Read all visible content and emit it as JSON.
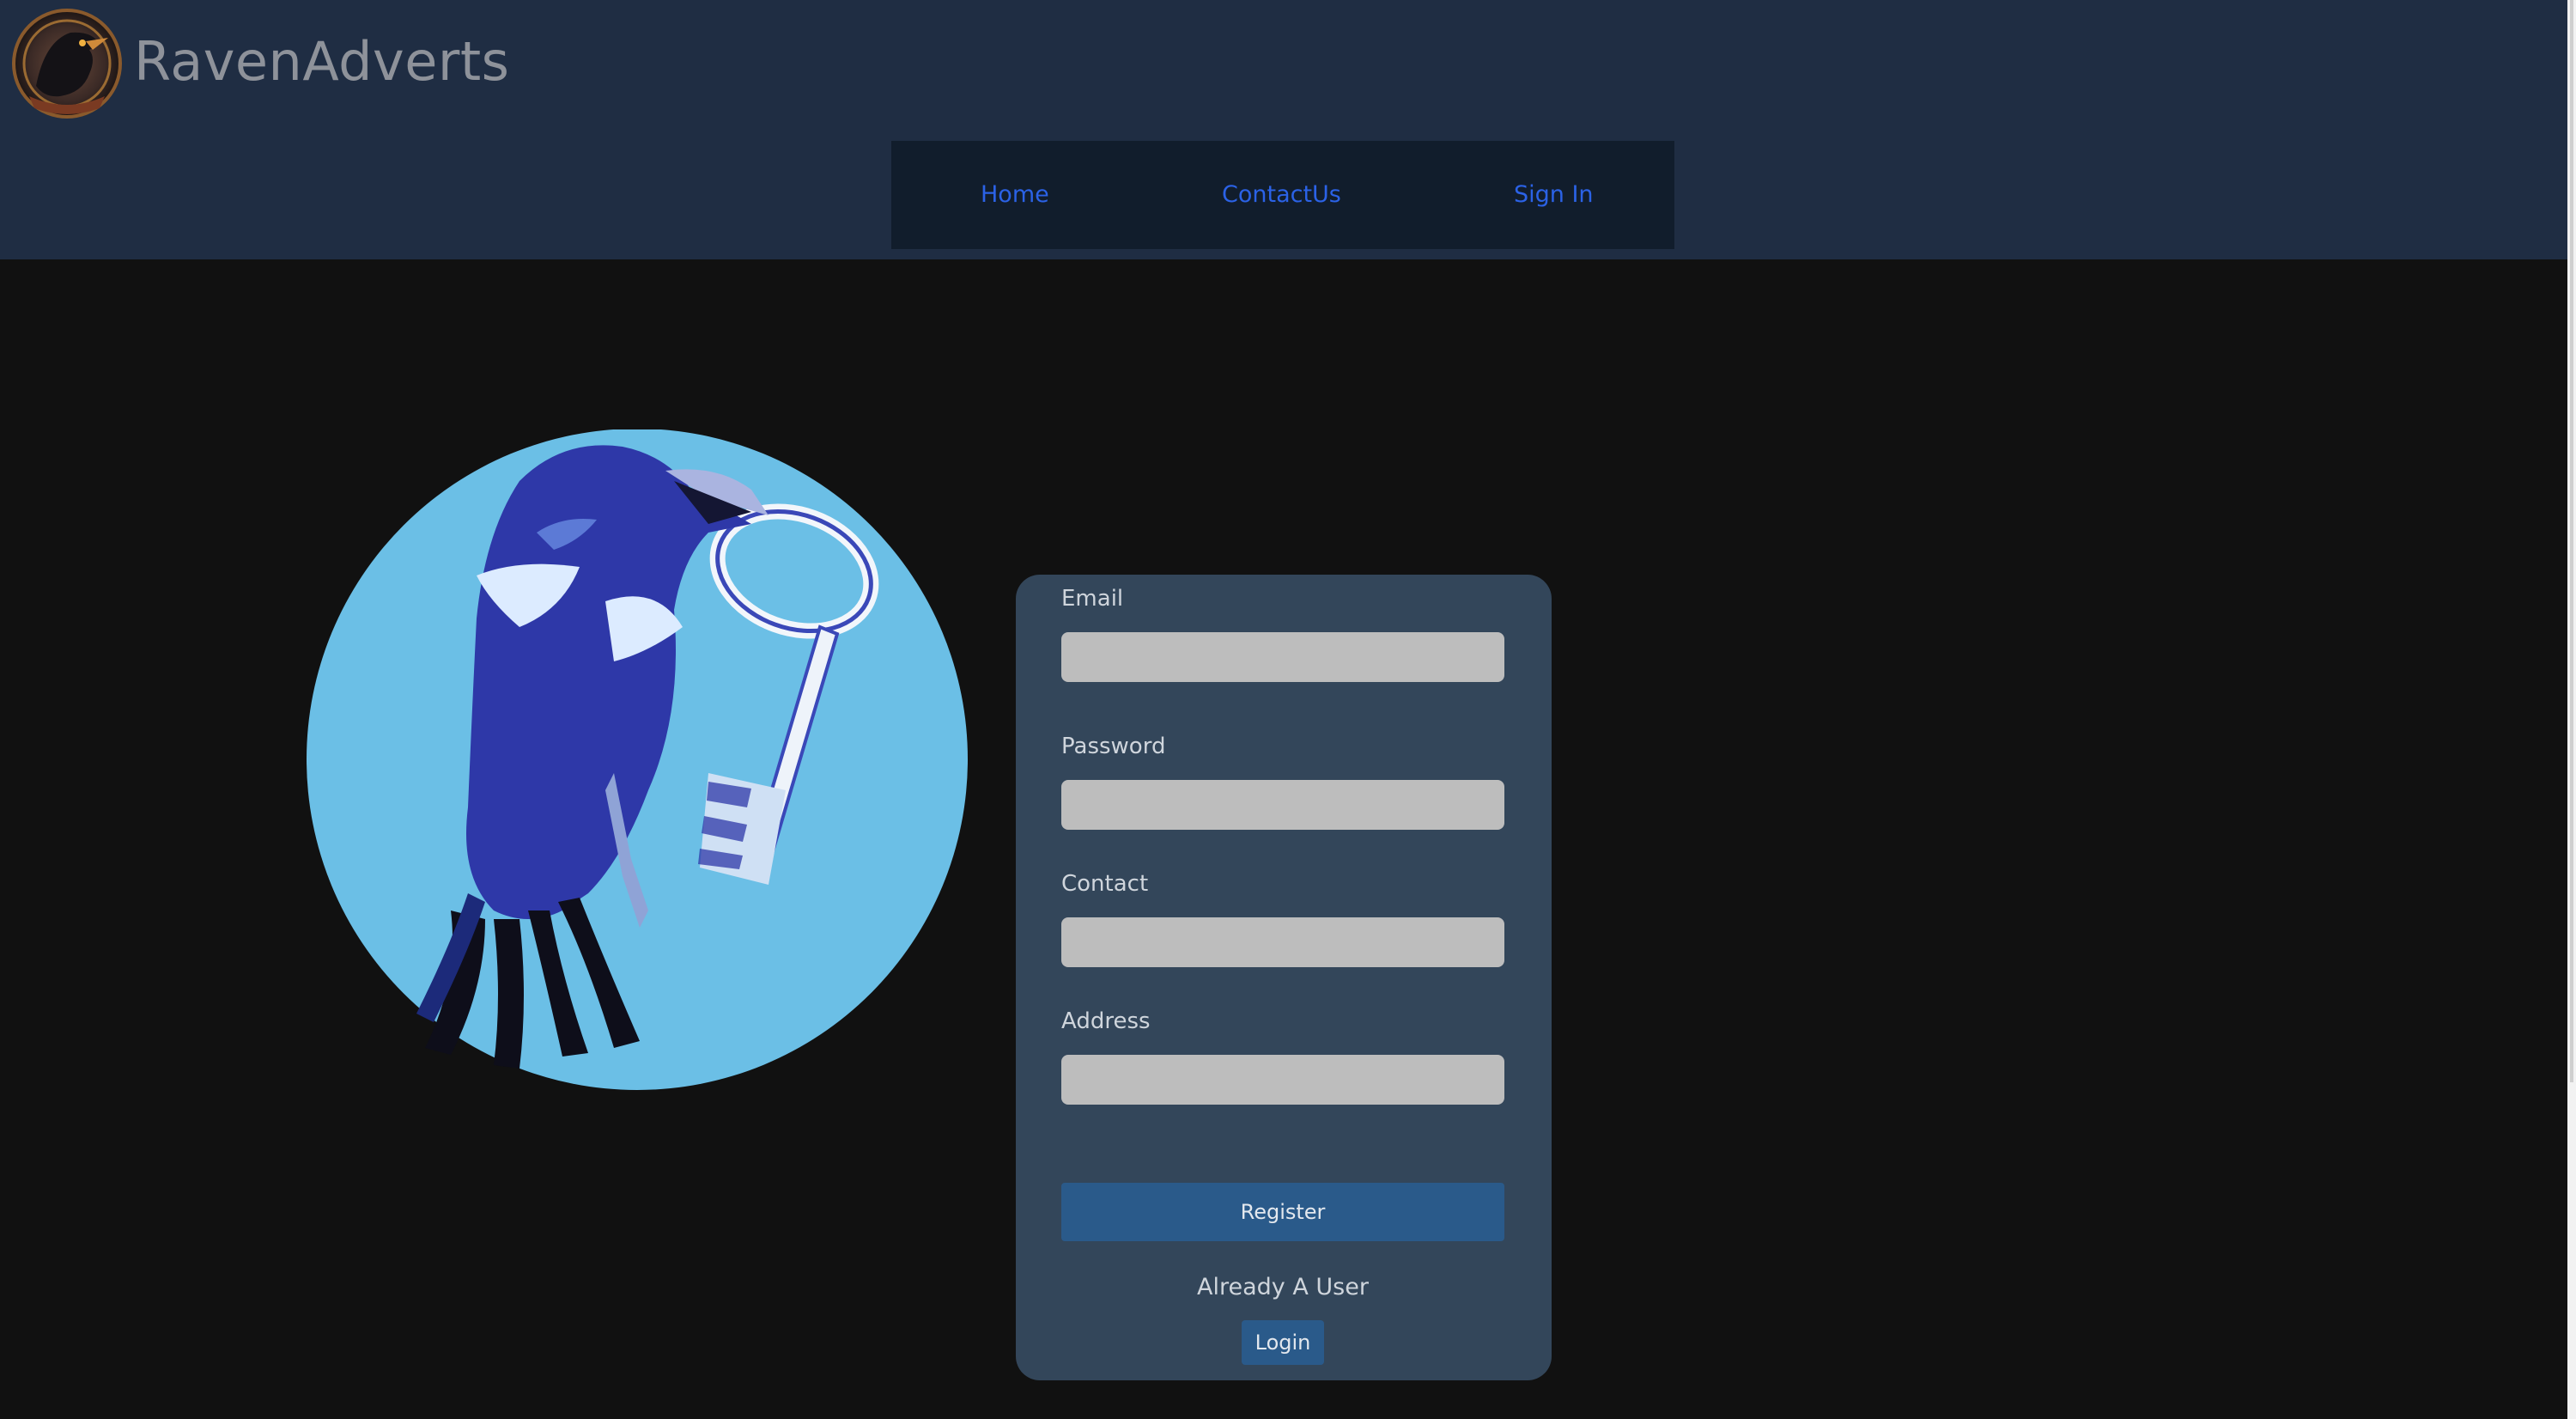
{
  "header": {
    "brand": "RavenAdverts",
    "logo_icon": "raven-logo-icon"
  },
  "nav": {
    "items": [
      {
        "label": "Home"
      },
      {
        "label": "ContactUs"
      },
      {
        "label": "Sign In"
      }
    ]
  },
  "form": {
    "email_label": "Email",
    "email_value": "",
    "password_label": "Password",
    "password_value": "",
    "contact_label": "Contact",
    "contact_value": "",
    "address_label": "Address",
    "address_value": "",
    "register_label": "Register",
    "already_user_text": "Already A User",
    "login_label": "Login"
  },
  "colors": {
    "header_bg": "#1f2d43",
    "nav_bg": "#111d2c",
    "nav_link": "#2b62e6",
    "page_bg": "#111111",
    "card_bg": "#33465a",
    "input_bg": "#bdbdbd",
    "button_bg": "#2a5a8a",
    "illustration_circle": "#6bbfe6",
    "raven_blue": "#2e38a8"
  },
  "illustration": {
    "icon": "raven-with-key-illustration"
  }
}
